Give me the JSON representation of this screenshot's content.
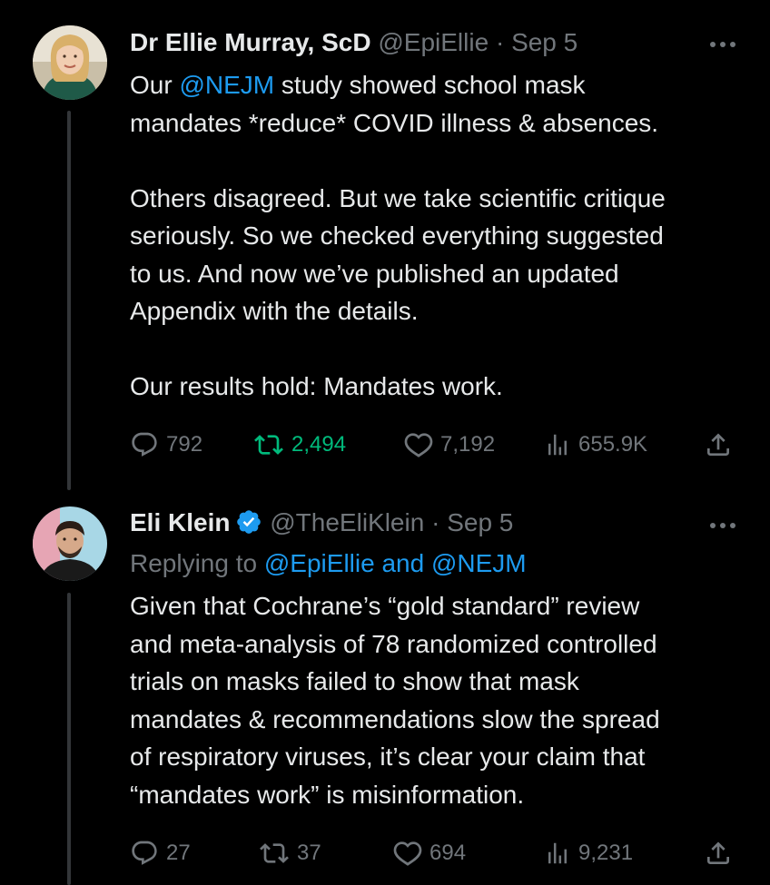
{
  "colors": {
    "background": "#000000",
    "text": "#e7e9ea",
    "muted": "#71767b",
    "link": "#1d9bf0",
    "retweet_active": "#00ba7c",
    "thread_line": "#333639"
  },
  "tweets": [
    {
      "display_name": "Dr Ellie Murray, ScD",
      "handle": "@EpiEllie",
      "separator": "·",
      "date": "Sep 5",
      "verified": false,
      "body": {
        "p1_mention": "@NEJM",
        "p1_prefix": "Our ",
        "p1_rest_line1": " study showed school mask",
        "p1_line2": "mandates *reduce* COVID illness & absences.",
        "p2_line1": "Others disagreed. But we take scientific critique",
        "p2_line2": "seriously. So we checked everything suggested",
        "p2_line3": "to us. And now we’ve published an updated",
        "p2_line4": "Appendix with the details.",
        "p3_line1": "Our results hold: Mandates work."
      },
      "stats": {
        "replies": "792",
        "retweets": "2,494",
        "likes": "7,192",
        "views": "655.9K"
      },
      "icons": [
        "reply-icon",
        "retweet-icon",
        "like-icon",
        "views-icon",
        "share-icon"
      ]
    },
    {
      "display_name": "Eli Klein",
      "handle": "@TheEliKlein",
      "separator": "·",
      "date": "Sep 5",
      "verified": true,
      "replying_to": {
        "prefix": "Replying to ",
        "users": "@EpiEllie and @NEJM"
      },
      "body": {
        "line1": "Given that Cochrane’s “gold standard” review",
        "line2": "and meta-analysis of 78 randomized controlled",
        "line3": "trials on masks failed to show that mask",
        "line4": "mandates & recommendations slow the spread",
        "line5": "of respiratory viruses, it’s clear your claim that",
        "line6": "“mandates work” is misinformation."
      },
      "stats": {
        "replies": "27",
        "retweets": "37",
        "likes": "694",
        "views": "9,231"
      },
      "icons": [
        "reply-icon",
        "retweet-icon",
        "like-icon",
        "views-icon",
        "share-icon"
      ]
    }
  ]
}
